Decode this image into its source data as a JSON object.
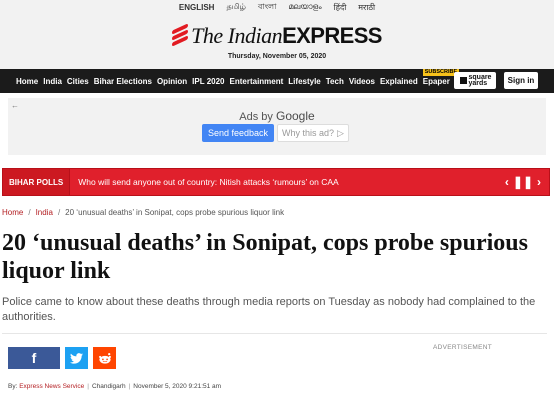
{
  "languages": [
    "ENGLISH",
    "தமிழ்",
    "বাংলা",
    "മലയാളം",
    "हिंदी",
    "मराठी"
  ],
  "masthead": {
    "logo_the": "The Indian",
    "logo_express": "EXPRESS",
    "date": "Thursday, November 05, 2020"
  },
  "nav": {
    "items": [
      "Home",
      "India",
      "Cities",
      "Bihar Elections",
      "Opinion",
      "IPL 2020",
      "Entertainment",
      "Lifestyle",
      "Tech",
      "Videos",
      "Explained"
    ],
    "subscribe_badge": "SUBSCRIBE",
    "epaper": "Epaper",
    "square_yards": "square yards",
    "signin": "Sign in"
  },
  "ad": {
    "ads_by": "Ads by",
    "google": "Google",
    "send_feedback": "Send feedback",
    "why_this_ad": "Why this ad?"
  },
  "ticker": {
    "tag": "BIHAR POLLS",
    "text": "Who will send anyone out of country: Nitish attacks ‘rumours’ on CAA"
  },
  "breadcrumb": {
    "home": "Home",
    "section": "India",
    "current": "20 ‘unusual deaths’ in Sonipat, cops probe spurious liquor link"
  },
  "article": {
    "headline": "20 ‘unusual deaths’ in Sonipat, cops probe spurious liquor link",
    "synopsis": "Police came to know about these deaths through media reports on Tuesday as nobody had complained to the authorities.",
    "advertisement_label": "ADVERTISEMENT",
    "byline": {
      "by": "By:",
      "author": "Express News Service",
      "location": "Chandigarh",
      "timestamp": "November 5, 2020 9:21:51 am"
    }
  },
  "colors": {
    "brand_red": "#e21b22",
    "nav_bg": "#1b1b1b",
    "ticker_red": "#e0202c",
    "facebook": "#3b5998",
    "twitter": "#1da1f2",
    "reddit": "#ff4500"
  }
}
